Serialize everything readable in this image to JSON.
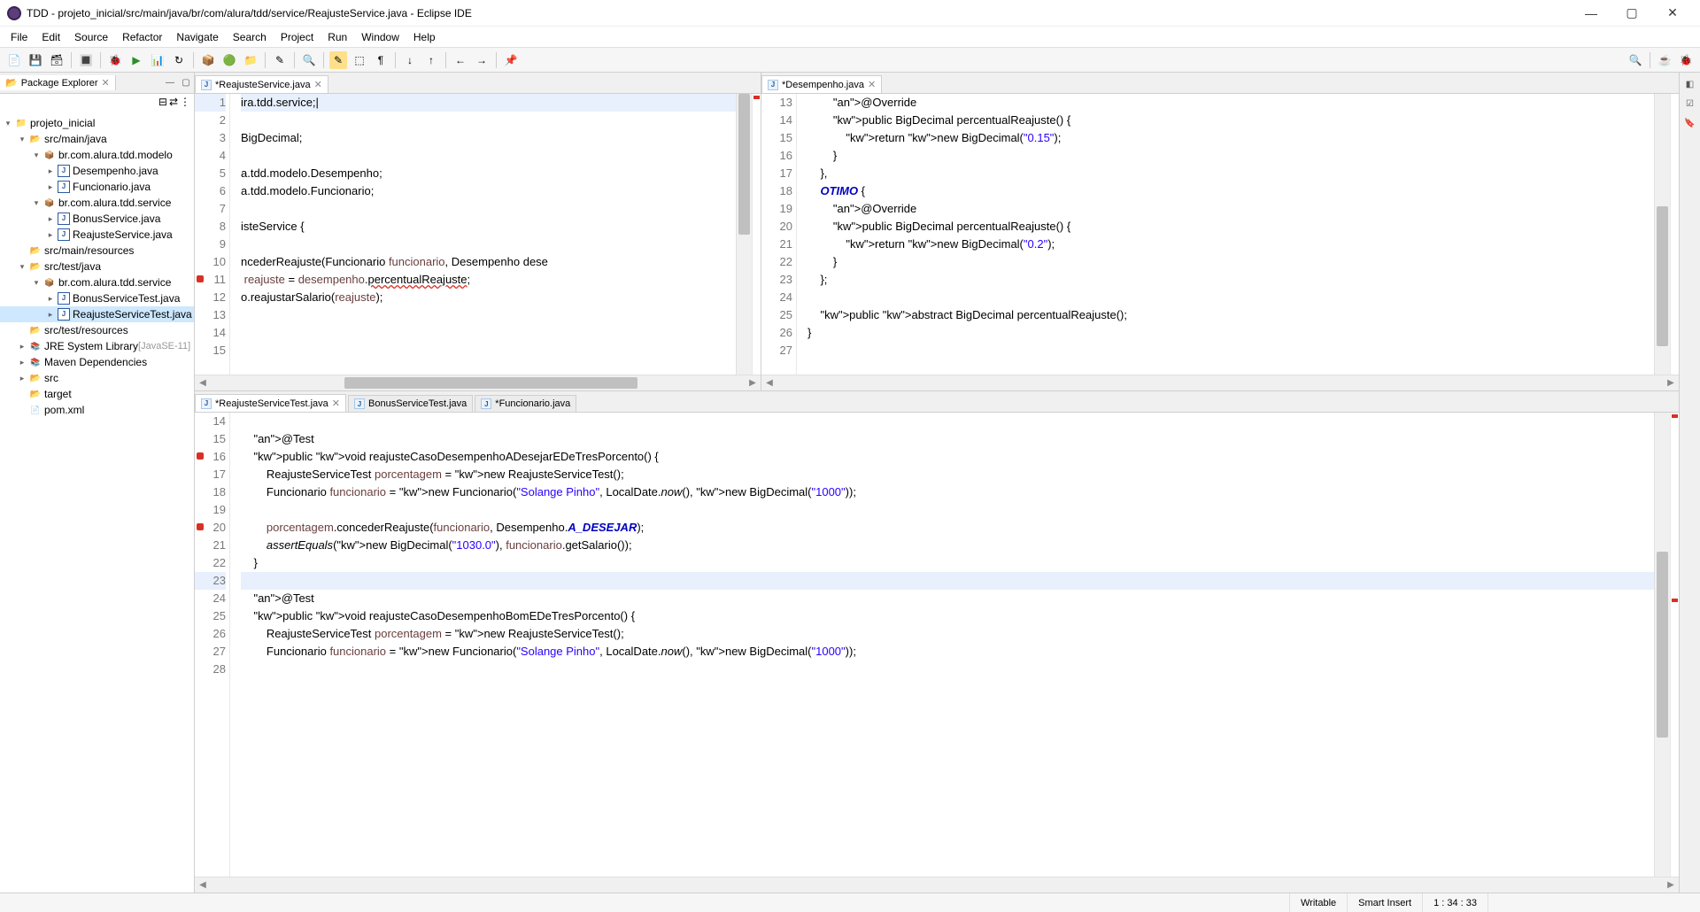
{
  "window": {
    "title": "TDD - projeto_inicial/src/main/java/br/com/alura/tdd/service/ReajusteService.java - Eclipse IDE"
  },
  "menu": [
    "File",
    "Edit",
    "Source",
    "Refactor",
    "Navigate",
    "Search",
    "Project",
    "Run",
    "Window",
    "Help"
  ],
  "explorer": {
    "title": "Package Explorer",
    "project": "projeto_inicial",
    "nodes": {
      "srcMainJava": "src/main/java",
      "pkgModelo": "br.com.alura.tdd.modelo",
      "desempenho": "Desempenho.java",
      "funcionario": "Funcionario.java",
      "pkgService": "br.com.alura.tdd.service",
      "bonusService": "BonusService.java",
      "reajusteService": "ReajusteService.java",
      "srcMainRes": "src/main/resources",
      "srcTestJava": "src/test/java",
      "pkgTestService": "br.com.alura.tdd.service",
      "bonusServiceTest": "BonusServiceTest.java",
      "reajusteServiceTest": "ReajusteServiceTest.java",
      "srcTestRes": "src/test/resources",
      "jre": "JRE System Library",
      "jreDeco": "[JavaSE-11]",
      "maven": "Maven Dependencies",
      "src": "src",
      "target": "target",
      "pom": "pom.xml"
    }
  },
  "editor1": {
    "tab": "*ReajusteService.java",
    "lines_start": 1,
    "code": [
      "ira.tdd.service;|",
      "",
      "BigDecimal;",
      "",
      "a.tdd.modelo.Desempenho;",
      "a.tdd.modelo.Funcionario;",
      "",
      "isteService {",
      "",
      "ncederReajuste(Funcionario funcionario, Desempenho dese",
      " reajuste = desempenho.percentualReajuste;",
      "o.reajustarSalario(reajuste);",
      "",
      "",
      ""
    ]
  },
  "editor2": {
    "tab": "*Desempenho.java",
    "lines_start": 13,
    "code": [
      "        @Override",
      "        public BigDecimal percentualReajuste() {",
      "            return new BigDecimal(\"0.15\");",
      "        }",
      "    },",
      "    OTIMO {",
      "        @Override",
      "        public BigDecimal percentualReajuste() {",
      "            return new BigDecimal(\"0.2\");",
      "        }",
      "    };",
      "",
      "    public abstract BigDecimal percentualReajuste();",
      "}",
      ""
    ]
  },
  "editor3": {
    "tabs": [
      "*ReajusteServiceTest.java",
      "BonusServiceTest.java",
      "*Funcionario.java"
    ],
    "lines_start": 14,
    "code": [
      "",
      "    @Test",
      "    public void reajusteCasoDesempenhoADesejarEDeTresPorcento() {",
      "        ReajusteServiceTest porcentagem = new ReajusteServiceTest();",
      "        Funcionario funcionario = new Funcionario(\"Solange Pinho\", LocalDate.now(), new BigDecimal(\"1000\"));",
      "",
      "        porcentagem.concederReajuste(funcionario, Desempenho.A_DESEJAR);",
      "        assertEquals(new BigDecimal(\"1030.0\"), funcionario.getSalario());",
      "    }",
      "",
      "    @Test",
      "    public void reajusteCasoDesempenhoBomEDeTresPorcento() {",
      "        ReajusteServiceTest porcentagem = new ReajusteServiceTest();",
      "        Funcionario funcionario = new Funcionario(\"Solange Pinho\", LocalDate.now(), new BigDecimal(\"1000\"));",
      ""
    ]
  },
  "status": {
    "writable": "Writable",
    "insert": "Smart Insert",
    "pos": "1 : 34 : 33"
  }
}
